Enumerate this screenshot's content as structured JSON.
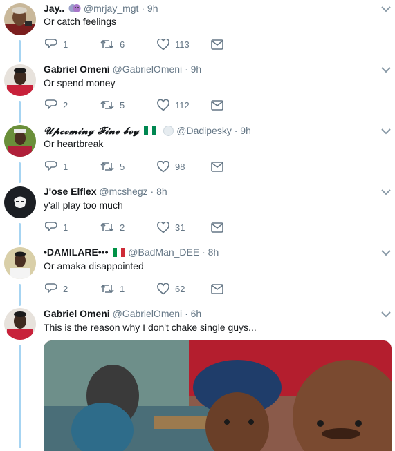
{
  "tweets": [
    {
      "name": "Jay..",
      "handle": "@mrjay_mgt",
      "dot": "·",
      "time": "9h",
      "text": "Or catch feelings",
      "replies": "1",
      "retweets": "6",
      "likes": "113"
    },
    {
      "name": "Gabriel Omeni",
      "handle": "@GabrielOmeni",
      "dot": "·",
      "time": "9h",
      "text": "Or spend money",
      "replies": "2",
      "retweets": "5",
      "likes": "112"
    },
    {
      "name": "𝓤𝓹𝓬𝓸𝓶𝓲𝓷𝓰 𝓕𝓲𝓷𝓮 𝓫𝓸𝔂",
      "handle": "@Dadipesky",
      "dot": "·",
      "time": "9h",
      "text": "Or heartbreak",
      "replies": "1",
      "retweets": "5",
      "likes": "98"
    },
    {
      "name": "J'ose Elflex",
      "handle": "@mcshegz",
      "dot": "·",
      "time": "8h",
      "text": "y'all play too much",
      "replies": "1",
      "retweets": "2",
      "likes": "31"
    },
    {
      "name": "•DAMILARE•••",
      "handle": "@BadMan_DEE",
      "dot": "·",
      "time": "8h",
      "text": "Or amaka disappointed",
      "replies": "2",
      "retweets": "1",
      "likes": "62"
    },
    {
      "name": "Gabriel Omeni",
      "handle": "@GabrielOmeni",
      "dot": "·",
      "time": "6h",
      "text": "This is the reason why I don't chake single guys..."
    }
  ],
  "colors": {
    "text": "#14171a",
    "secondary": "#657786",
    "thread_line": "#a6d4f2",
    "nigeria_green": "#008751",
    "italy_green": "#009246",
    "italy_red": "#ce2b37"
  },
  "icons": [
    "reply-icon",
    "retweet-icon",
    "like-icon",
    "direct-message-icon",
    "caret-down-icon"
  ]
}
